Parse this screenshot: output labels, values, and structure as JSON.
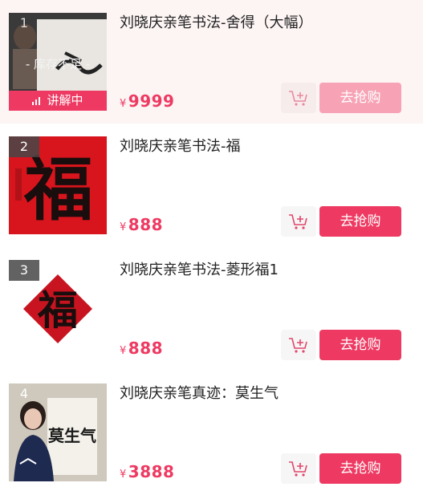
{
  "items": [
    {
      "rank": "1",
      "title": "刘晓庆亲笔书法-舍得（大幅）",
      "price_symbol": "¥",
      "price": "9999",
      "stock_note": "- 库存不足 -",
      "live_label": "讲解中",
      "buy_label": "去抢购",
      "buy_enabled": false
    },
    {
      "rank": "2",
      "title": "刘晓庆亲笔书法-福",
      "price_symbol": "¥",
      "price": "888",
      "buy_label": "去抢购",
      "buy_enabled": true
    },
    {
      "rank": "3",
      "title": "刘晓庆亲笔书法-菱形福1",
      "price_symbol": "¥",
      "price": "888",
      "buy_label": "去抢购",
      "buy_enabled": true
    },
    {
      "rank": "4",
      "title": "刘晓庆亲笔真迹：莫生气",
      "price_symbol": "¥",
      "price": "3888",
      "buy_label": "去抢购",
      "buy_enabled": true
    }
  ],
  "artwork_text": {
    "fu": "福",
    "mo_sheng_qi": "莫生气"
  },
  "colors": {
    "accent": "#ee3a62",
    "accent_disabled": "#f7a3b5",
    "price": "#ee3a62",
    "active_row_bg": "#fdf4f4",
    "poster_red": "#d8141c"
  }
}
